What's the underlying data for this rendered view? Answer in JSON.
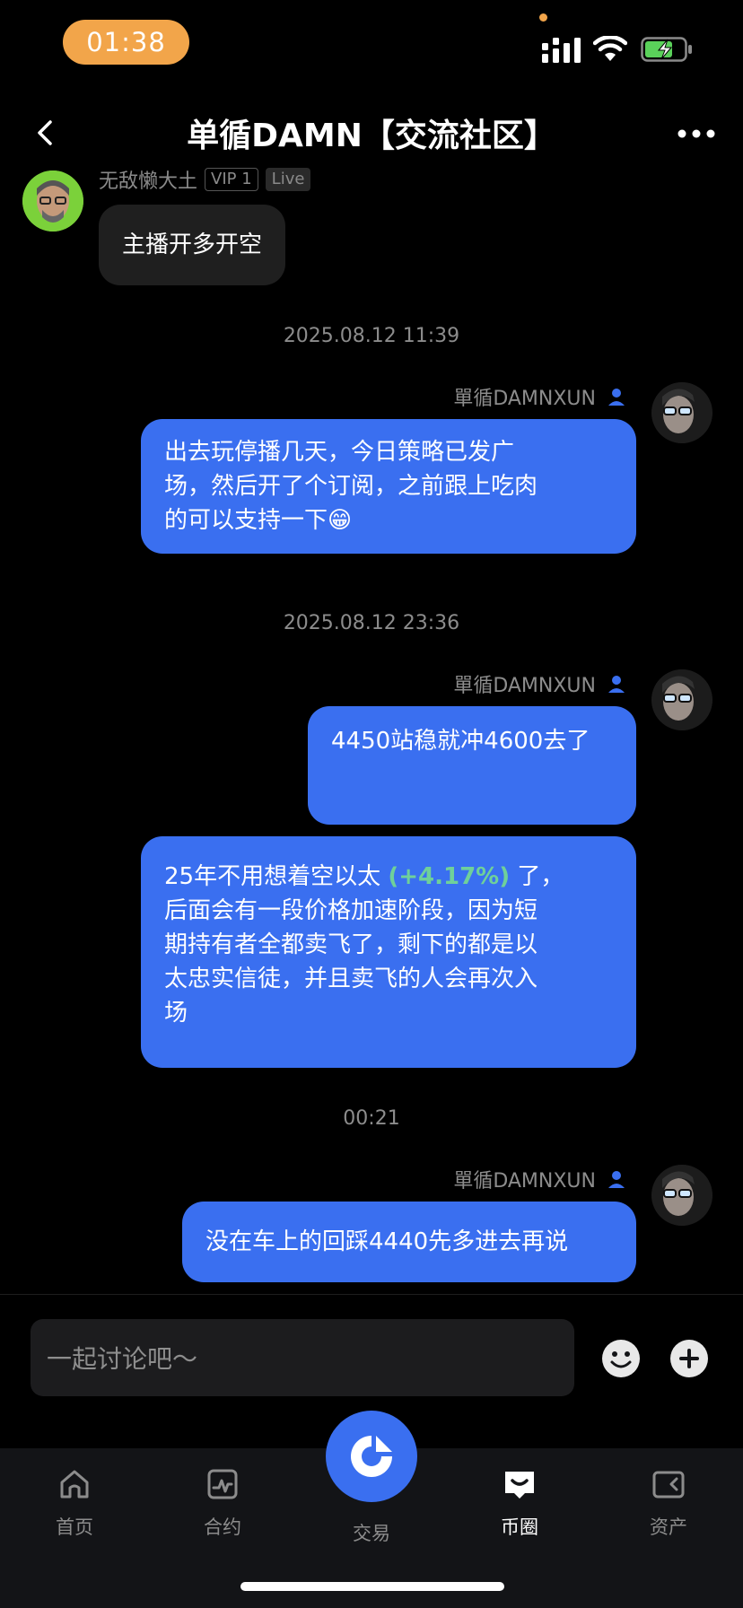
{
  "status_bar": {
    "time": "01:38"
  },
  "nav": {
    "title": "单循DAMN【交流社区】",
    "back_icon": "chevron-left-icon",
    "more_icon": "ellipsis-icon"
  },
  "messages": {
    "m1": {
      "user": "无敌懒大土",
      "vip_tag": "VIP 1",
      "live_tag": "Live",
      "text": "主播开多开空"
    },
    "t1": "2025.08.12 11:39",
    "m2": {
      "user": "單循DAMNXUN",
      "lines": [
        "出去玩停播几天，今日策略已发广",
        "场，然后开了个订阅，之前跟上吃肉",
        "的可以支持一下😁"
      ]
    },
    "t2": "2025.08.12 23:36",
    "m3": {
      "user": "單循DAMNXUN",
      "text": "4450站稳就冲4600去了"
    },
    "m4": {
      "line1_pre": "25年不用想着空以太 ",
      "line1_change": "(+4.17%)",
      "line1_post": " 了，",
      "lines": [
        "后面会有一段价格加速阶段，因为短",
        "期持有者全都卖飞了，剩下的都是以",
        "太忠实信徒，并且卖飞的人会再次入",
        "场"
      ]
    },
    "t3": "00:21",
    "m5": {
      "user": "單循DAMNXUN",
      "text": "没在车上的回踩4440先多进去再说"
    }
  },
  "input": {
    "placeholder": "一起讨论吧～"
  },
  "tabs": [
    {
      "label": "首页",
      "icon": "home-icon"
    },
    {
      "label": "合约",
      "icon": "chart-icon"
    },
    {
      "label": "交易",
      "icon": "trade-icon"
    },
    {
      "label": "币圈",
      "icon": "community-icon"
    },
    {
      "label": "资产",
      "icon": "wallet-icon"
    }
  ],
  "colors": {
    "accent": "#3a6ff0",
    "positive": "#6fd09a",
    "time_pill": "#f2a54a"
  }
}
